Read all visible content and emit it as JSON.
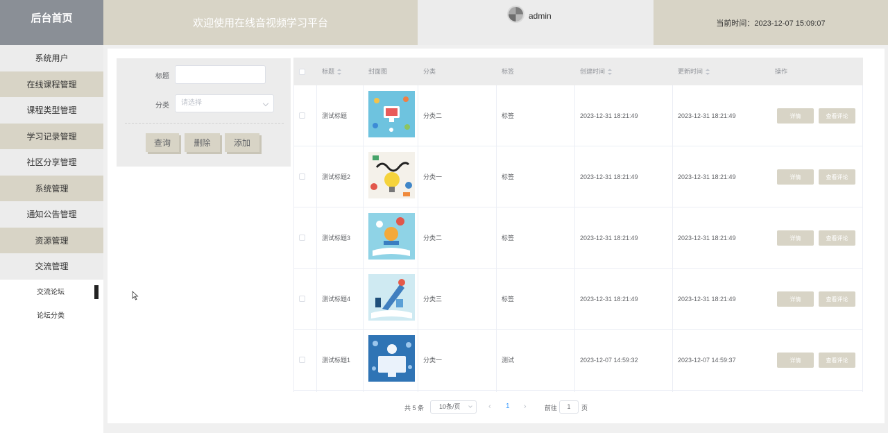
{
  "header": {
    "brand": "后台首页",
    "welcome": "欢迎使用在线音视频学习平台",
    "username": "admin",
    "current_time": "当前时间：2023-12-07 15:09:07"
  },
  "sidebar": {
    "items": [
      {
        "label": "系统用户"
      },
      {
        "label": "在线课程管理"
      },
      {
        "label": "课程类型管理"
      },
      {
        "label": "学习记录管理"
      },
      {
        "label": "社区分享管理"
      },
      {
        "label": "系统管理"
      },
      {
        "label": "通知公告管理"
      },
      {
        "label": "资源管理"
      },
      {
        "label": "交流管理"
      }
    ],
    "subitems": [
      {
        "label": "交流论坛",
        "active": true
      },
      {
        "label": "论坛分类",
        "active": false
      }
    ]
  },
  "search": {
    "title_label": "标题",
    "title_value": "",
    "category_label": "分类",
    "category_placeholder": "请选择",
    "query_button": "查询",
    "delete_button": "删除",
    "add_button": "添加"
  },
  "table": {
    "headers": {
      "title": "标题",
      "cover": "封面图",
      "category": "分类",
      "tags": "标签",
      "created": "创建时间",
      "updated": "更新时间",
      "actions": "操作"
    },
    "rows": [
      {
        "title": "测试标题",
        "category": "分类二",
        "tags": "标签",
        "created": "2023-12-31 18:21:49",
        "updated": "2023-12-31 18:21:49"
      },
      {
        "title": "测试标题2",
        "category": "分类一",
        "tags": "标签",
        "created": "2023-12-31 18:21:49",
        "updated": "2023-12-31 18:21:49"
      },
      {
        "title": "测试标题3",
        "category": "分类二",
        "tags": "标签",
        "created": "2023-12-31 18:21:49",
        "updated": "2023-12-31 18:21:49"
      },
      {
        "title": "测试标题4",
        "category": "分类三",
        "tags": "标签",
        "created": "2023-12-31 18:21:49",
        "updated": "2023-12-31 18:21:49"
      },
      {
        "title": "测试标题1",
        "category": "分类一",
        "tags": "测试",
        "created": "2023-12-07 14:59:32",
        "updated": "2023-12-07 14:59:37"
      }
    ],
    "detail_button": "详情",
    "comments_button": "查看评论"
  },
  "pagination": {
    "total": "共 5 条",
    "page_size": "10条/页",
    "current_page": "1",
    "goto_label": "前往",
    "goto_value": "1",
    "page_suffix": "页"
  },
  "colors": {
    "accent_tan": "#d8d4c6",
    "brand_gray": "#8a8f96",
    "panel_gray": "#ececec",
    "link_blue": "#409eff"
  }
}
